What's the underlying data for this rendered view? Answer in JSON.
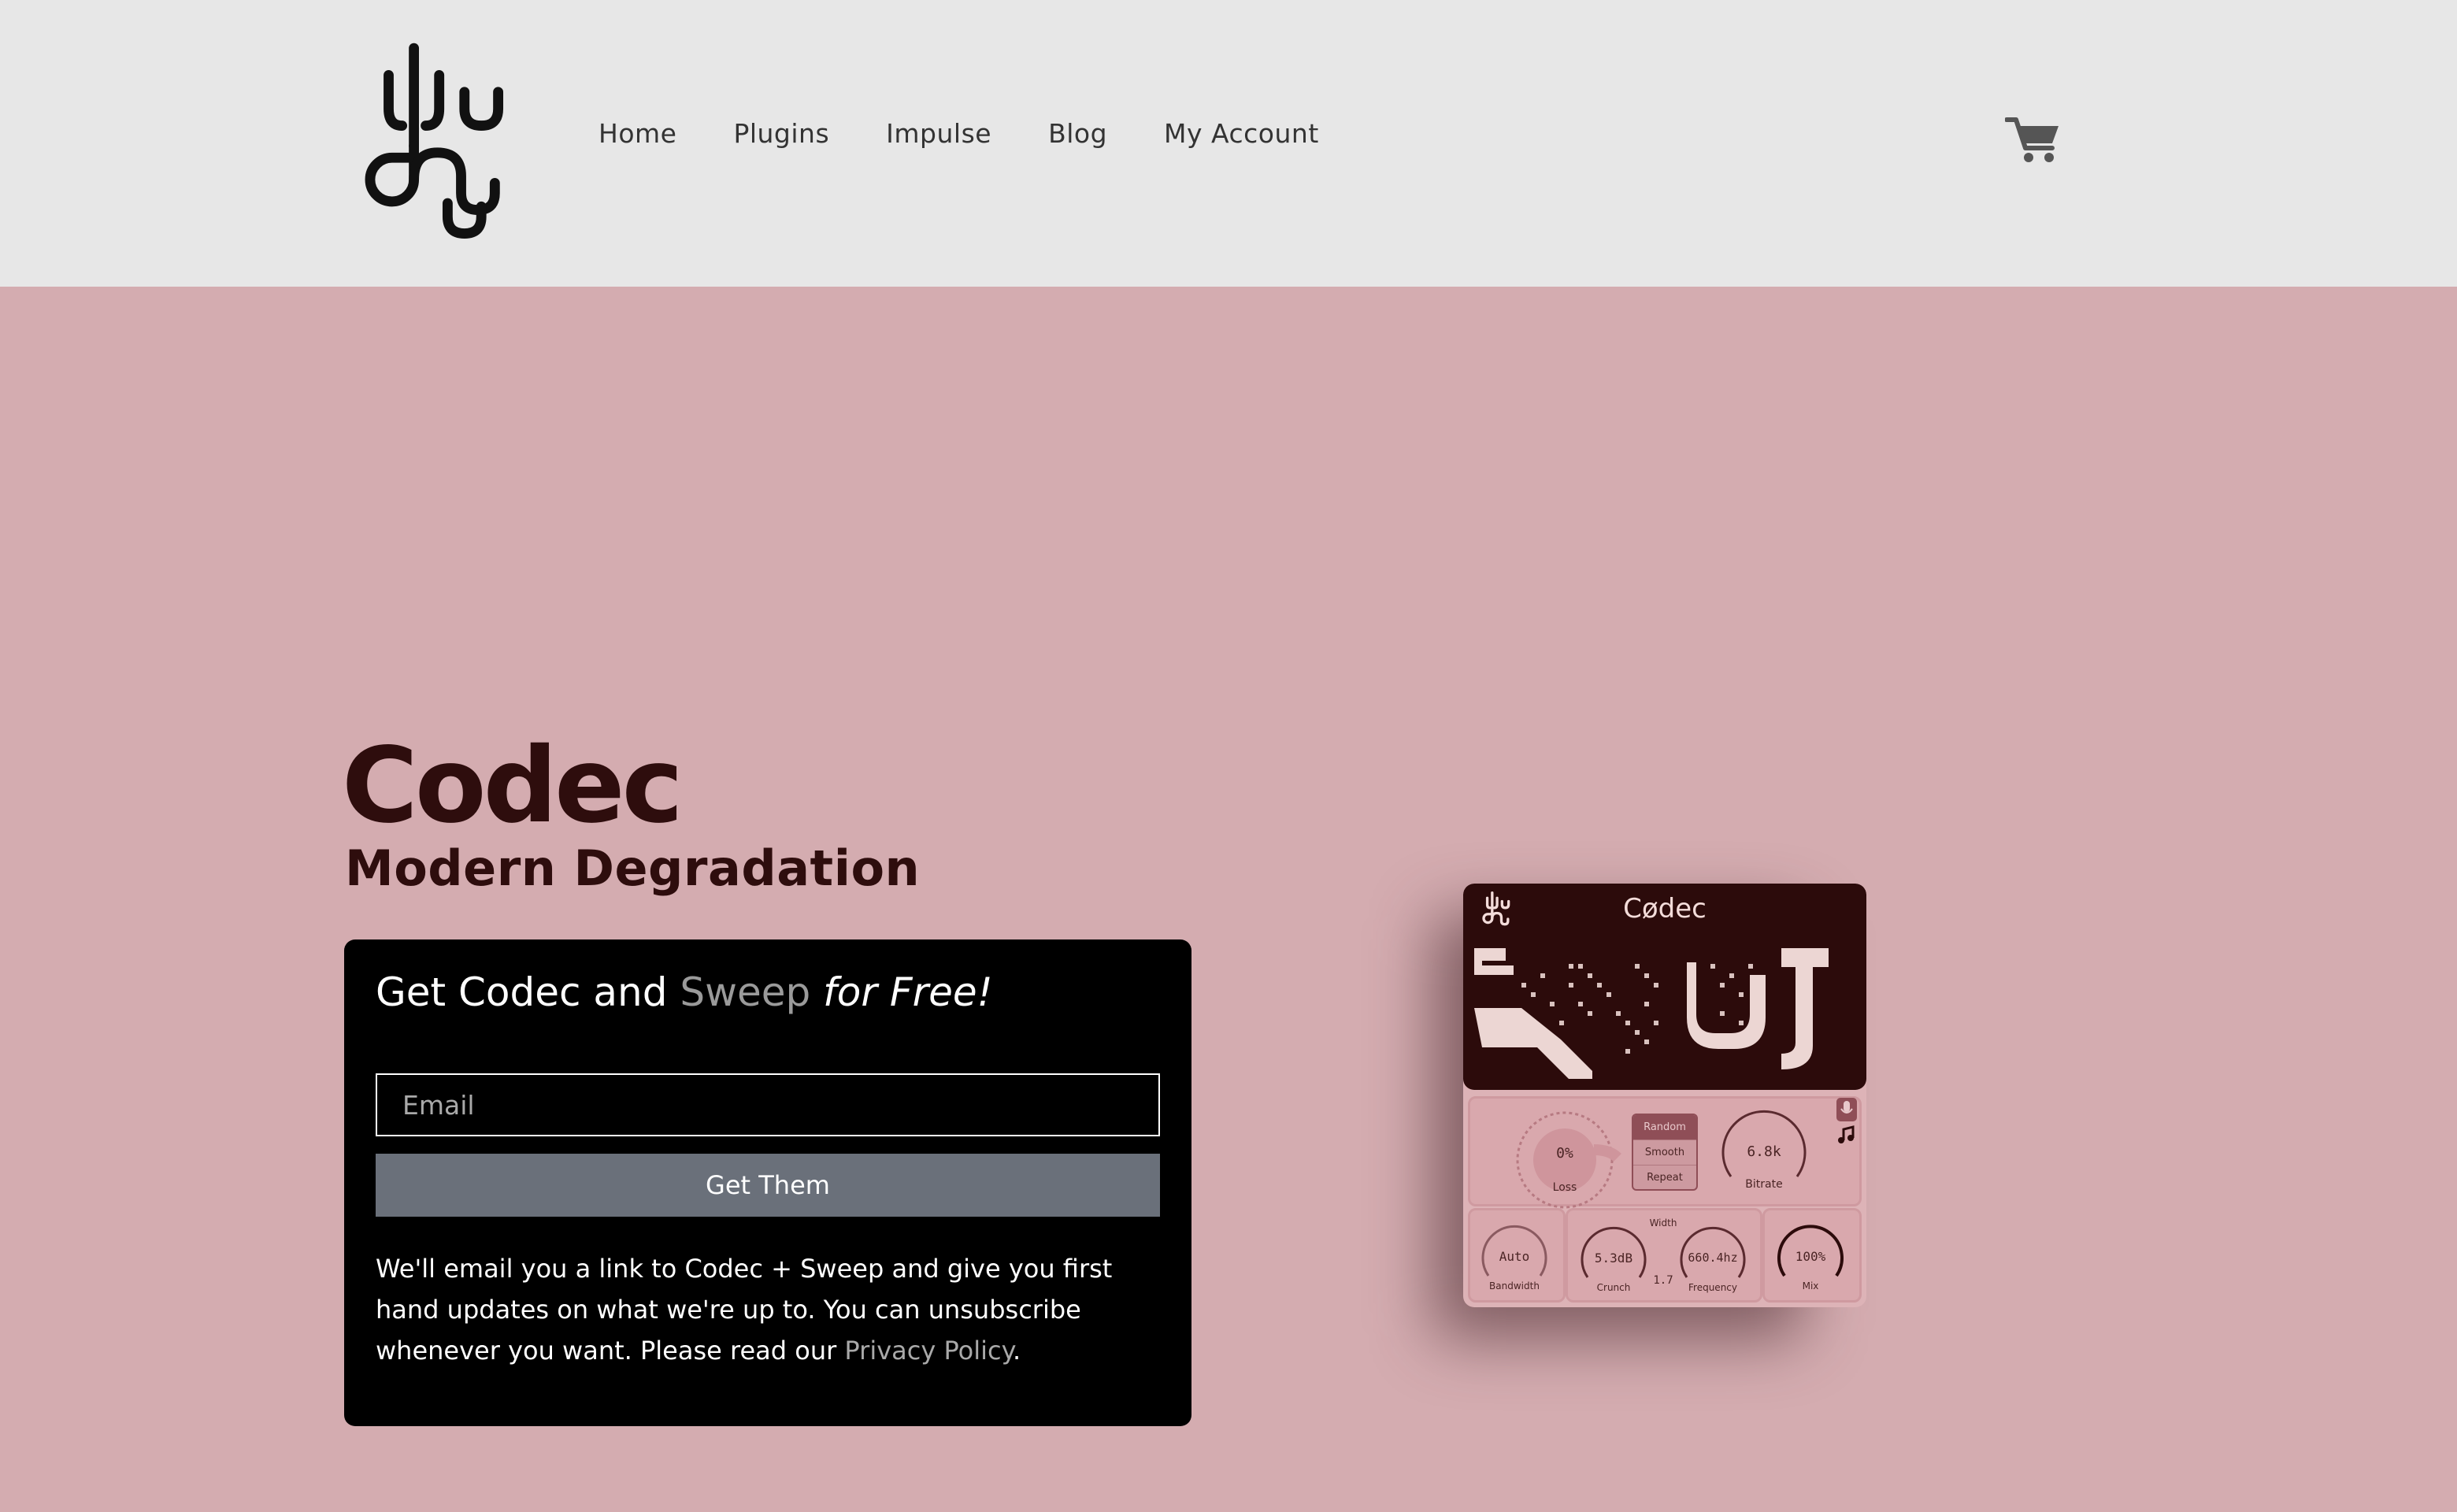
{
  "header": {
    "logo": "dtds-logo",
    "nav": [
      "Home",
      "Plugins",
      "Impulse",
      "Blog",
      "My Account"
    ],
    "cart_icon": "cart-icon"
  },
  "hero": {
    "title": "Codec",
    "subtitle": "Modern Degradation"
  },
  "signup": {
    "heading_part1": "Get Codec and ",
    "heading_highlight": "Sweep",
    "heading_emphasis": "for Free!",
    "email_placeholder": "Email",
    "button_label": "Get Them",
    "notice_text": "We'll email you a link to Codec + Sweep and give you first hand updates on what we're up to. You can unsubscribe whenever you want. Please read our ",
    "privacy_link": "Privacy Policy",
    "notice_end": "."
  },
  "plugin": {
    "name": "Cødec",
    "modes": [
      "Random",
      "Smooth",
      "Repeat"
    ],
    "active_mode": "Random",
    "knobs": {
      "loss": {
        "value": "0%",
        "label": "Loss"
      },
      "bitrate": {
        "value": "6.8k",
        "label": "Bitrate"
      },
      "bandwidth": {
        "value": "Auto",
        "label": "Bandwidth"
      },
      "crunch": {
        "value": "5.3dB",
        "label": "Crunch"
      },
      "frequency": {
        "value": "660.4hz",
        "label": "Frequency"
      },
      "mix": {
        "value": "100%",
        "label": "Mix"
      },
      "width_label": "Width",
      "width_value": "1.7"
    }
  },
  "colors": {
    "page_bg": "#d4acb0",
    "header_bg": "#e7e7e7",
    "heading_text": "#2e0d0d",
    "card_bg": "#000000",
    "button_bg": "#6a707a",
    "plugin_dark": "#2c0b0b"
  }
}
